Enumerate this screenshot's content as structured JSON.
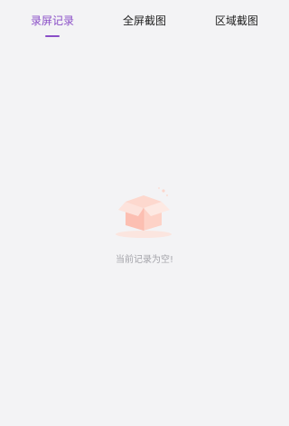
{
  "tabs": [
    {
      "label": "录屏记录",
      "active": true
    },
    {
      "label": "全屏截图",
      "active": false
    },
    {
      "label": "区域截图",
      "active": false
    }
  ],
  "empty_state": {
    "icon": "empty-box-icon",
    "message": "当前记录为空!"
  },
  "colors": {
    "background": "#f3f3f5",
    "accent": "#8a4ec7",
    "tab_text": "#222222",
    "empty_text": "#a4a4aa",
    "box": "#fcc8bc"
  }
}
